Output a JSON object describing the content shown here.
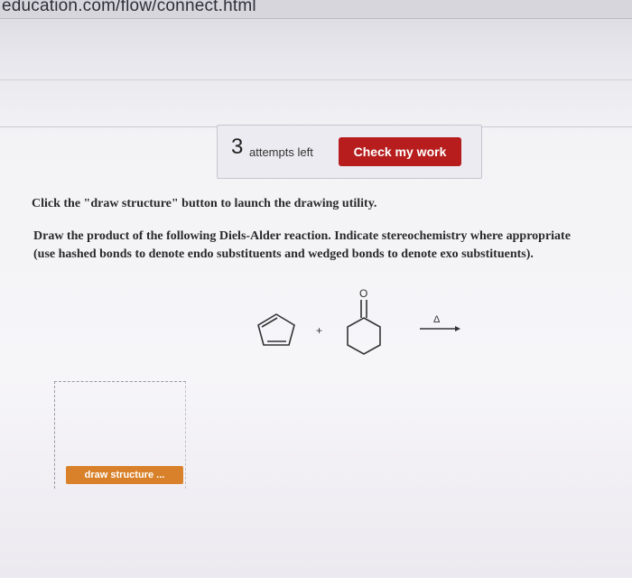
{
  "browser": {
    "url_fragment": "education.com/flow/connect.html"
  },
  "attempts": {
    "count": "3",
    "label": "attempts left"
  },
  "check_button": {
    "label": "Check my work"
  },
  "instruction": "Click the \"draw structure\" button to launch the drawing utility.",
  "question": {
    "line1": "Draw the product of the following Diels-Alder reaction. Indicate stereochemistry where appropriate",
    "line2": "(use hashed bonds to denote endo substituents and wedged bonds to denote exo substituents)."
  },
  "reaction": {
    "plus": "+",
    "carbonyl_atom": "O",
    "condition": "Δ"
  },
  "draw_button": {
    "label": "draw structure ..."
  },
  "colors": {
    "check_button": "#b71d1d",
    "draw_button": "#d9812a"
  }
}
